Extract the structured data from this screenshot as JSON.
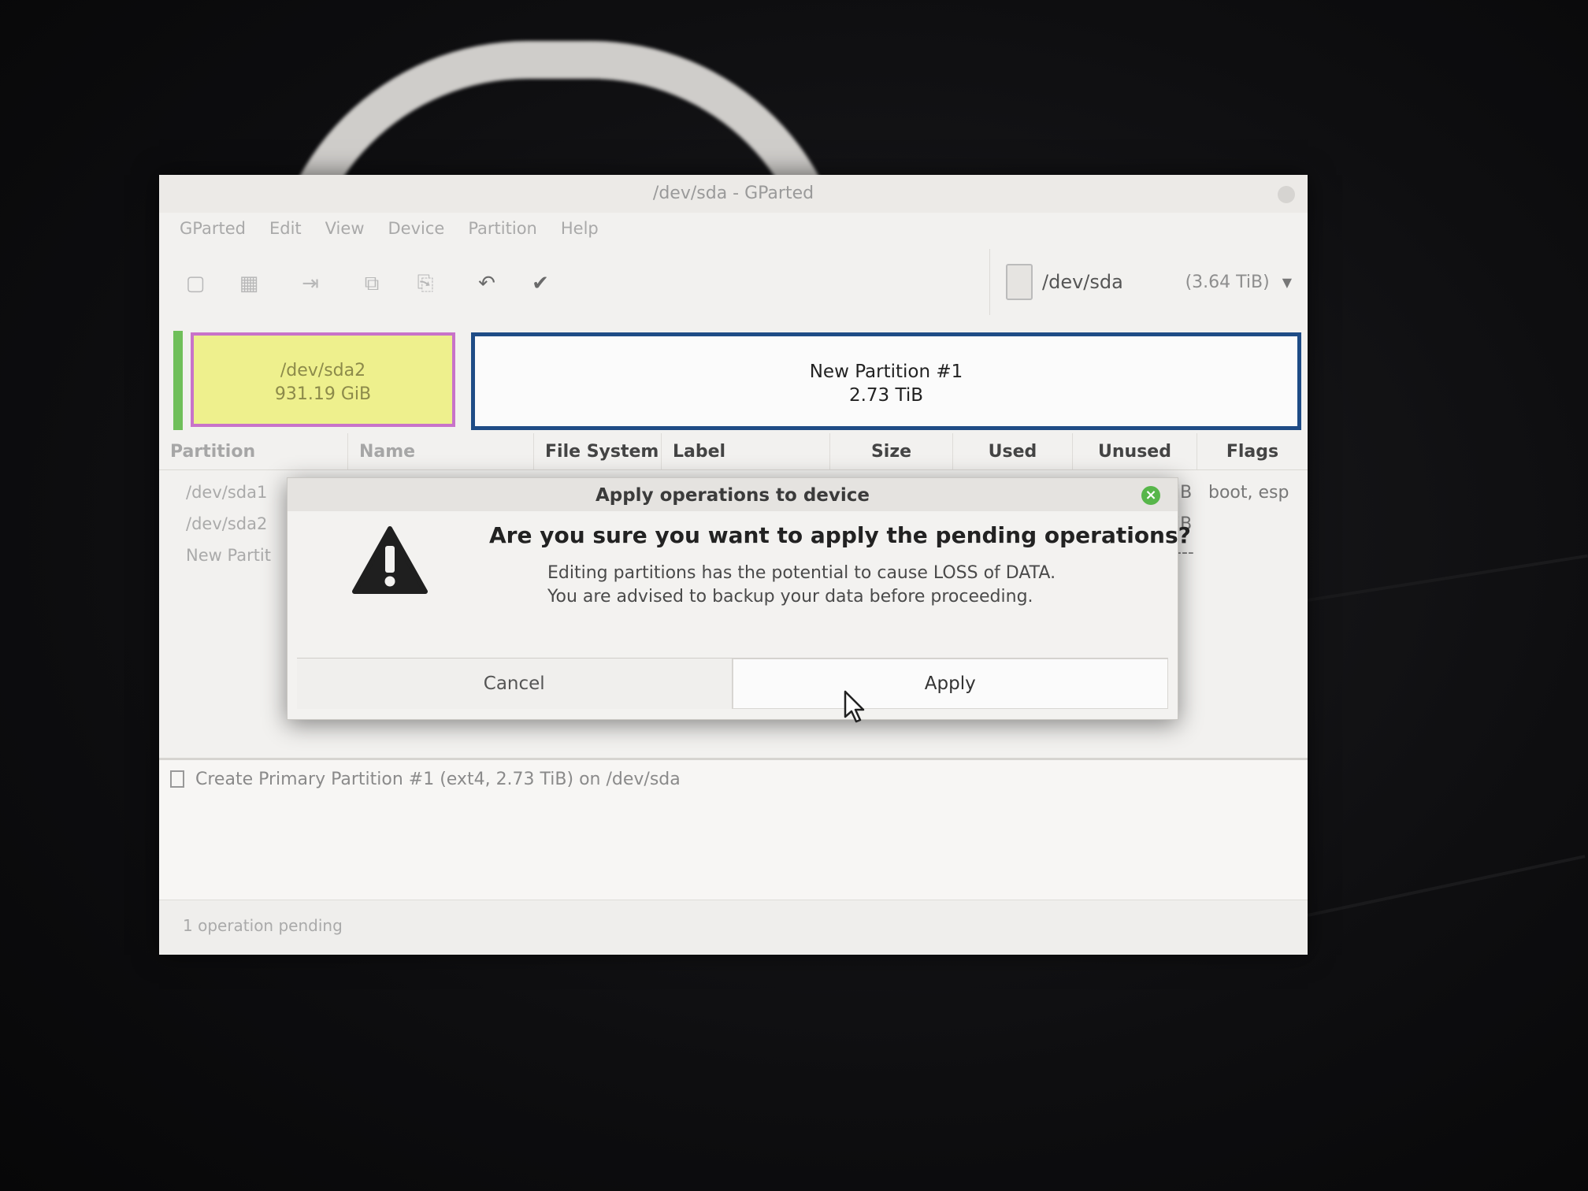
{
  "window": {
    "title": "/dev/sda - GParted"
  },
  "menubar": [
    "GParted",
    "Edit",
    "View",
    "Device",
    "Partition",
    "Help"
  ],
  "toolbar": {
    "tools": [
      {
        "icon": "new-icon",
        "glyph": "▢"
      },
      {
        "icon": "delete-icon",
        "glyph": "▦"
      },
      {
        "icon": "resize-move-icon",
        "glyph": "⇥"
      },
      {
        "icon": "copy-icon",
        "glyph": "⧉"
      },
      {
        "icon": "paste-icon",
        "glyph": "⎘"
      },
      {
        "icon": "undo-icon",
        "glyph": "↶"
      },
      {
        "icon": "apply-icon",
        "glyph": "✔"
      }
    ],
    "device": "/dev/sda",
    "device_size": "(3.64 TiB)"
  },
  "partition_map": {
    "sda2": {
      "name": "/dev/sda2",
      "size": "931.19 GiB"
    },
    "new": {
      "name": "New Partition #1",
      "size": "2.73 TiB"
    }
  },
  "table": {
    "columns": [
      "Partition",
      "Name",
      "File System",
      "Label",
      "Size",
      "Used",
      "Unused",
      "Flags"
    ],
    "rows": [
      {
        "partition": "/dev/sda1",
        "flags": "boot, esp",
        "unused_tail": "iB"
      },
      {
        "partition": "/dev/sda2",
        "flags": "",
        "unused_tail": "iB"
      },
      {
        "partition": "New Partit",
        "flags": "",
        "unused_tail": "---"
      }
    ]
  },
  "operations": {
    "items": [
      "Create Primary Partition #1 (ext4, 2.73 TiB) on /dev/sda"
    ],
    "status": "1 operation pending"
  },
  "dialog": {
    "title": "Apply operations to device",
    "heading": "Are you sure you want to apply the pending operations?",
    "body_line1": "Editing partitions has the potential to cause LOSS of DATA.",
    "body_line2": "You are advised to backup your data before proceeding.",
    "cancel_label": "Cancel",
    "apply_label": "Apply"
  }
}
